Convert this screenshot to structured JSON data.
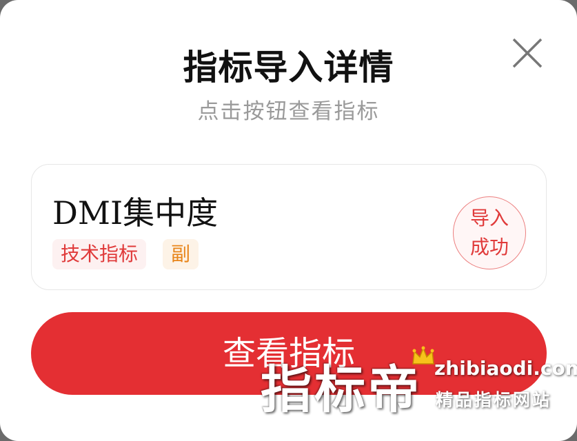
{
  "dialog": {
    "title": "指标导入详情",
    "subtitle": "点击按钮查看指标"
  },
  "close_icon": "close-icon",
  "indicator": {
    "name": "DMI集中度",
    "tags": {
      "type": "技术指标",
      "role": "副"
    },
    "status_line1": "导入",
    "status_line2": "成功"
  },
  "action": {
    "view_label": "查看指标"
  },
  "watermark": {
    "brand": "指标帝",
    "url": "zhibiaodi.com",
    "tagline": "精品指标网站"
  },
  "colors": {
    "accent": "#e42f33",
    "tag_type": "#e03a3a",
    "tag_role": "#e8851a",
    "subtitle": "#9a9a9a"
  }
}
